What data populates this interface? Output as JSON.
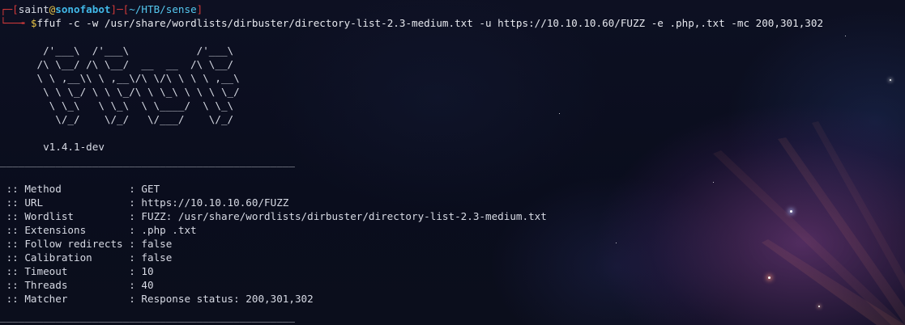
{
  "prompt": {
    "frame_top_left": "┌─[",
    "user": "saint",
    "at": "@",
    "host": "sonofabot",
    "frame_mid": "]─[",
    "path": "~/HTB/sense",
    "frame_end": "]",
    "frame_bottom": "└──╼ ",
    "dollar": "$",
    "command": "ffuf -c -w /usr/share/wordlists/dirbuster/directory-list-2.3-medium.txt -u https://10.10.10.60/FUZZ -e .php,.txt -mc 200,301,302"
  },
  "banner": {
    "ascii_lines": [
      "       /'___\\  /'___\\           /'___\\       ",
      "      /\\ \\__/ /\\ \\__/  __  __  /\\ \\__/       ",
      "      \\ \\ ,__\\\\ \\ ,__\\/\\ \\/\\ \\ \\ \\ ,__\\      ",
      "       \\ \\ \\_/ \\ \\ \\_/\\ \\ \\_\\ \\ \\ \\ \\_/      ",
      "        \\ \\_\\   \\ \\_\\  \\ \\____/  \\ \\_\\       ",
      "         \\/_/    \\/_/   \\/___/    \\/_/       "
    ],
    "version": "       v1.4.1-dev"
  },
  "separator": "________________________________________________",
  "config": [
    {
      "key": " :: Method           ",
      "value": ": GET"
    },
    {
      "key": " :: URL              ",
      "value": ": https://10.10.10.60/FUZZ"
    },
    {
      "key": " :: Wordlist         ",
      "value": ": FUZZ: /usr/share/wordlists/dirbuster/directory-list-2.3-medium.txt"
    },
    {
      "key": " :: Extensions       ",
      "value": ": .php .txt"
    },
    {
      "key": " :: Follow redirects ",
      "value": ": false"
    },
    {
      "key": " :: Calibration      ",
      "value": ": false"
    },
    {
      "key": " :: Timeout          ",
      "value": ": 10"
    },
    {
      "key": " :: Threads          ",
      "value": ": 40"
    },
    {
      "key": " :: Matcher          ",
      "value": ": Response status: 200,301,302"
    }
  ],
  "colors": {
    "prompt_frame": "#d13a3a",
    "host": "#41b8e8",
    "path": "#55c8f0",
    "dollar": "#e8c547"
  }
}
